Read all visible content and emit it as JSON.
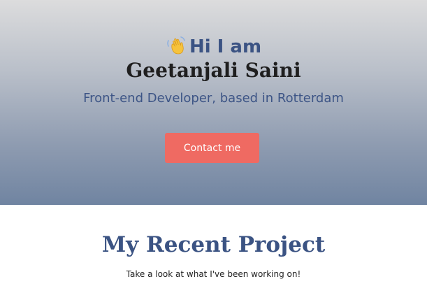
{
  "hero": {
    "greeting": "Hi I am",
    "name": "Geetanjali Saini",
    "subtitle": "Front-end Developer, based in Rotterdam",
    "contact_label": "Contact me",
    "wave_icon": "waving-hand-icon"
  },
  "projects": {
    "title": "My Recent Project",
    "subtitle": "Take a look at what I've been working on!"
  },
  "colors": {
    "accent": "#3b5383",
    "button": "#ef6a62",
    "name_text": "#1f1f1f"
  }
}
